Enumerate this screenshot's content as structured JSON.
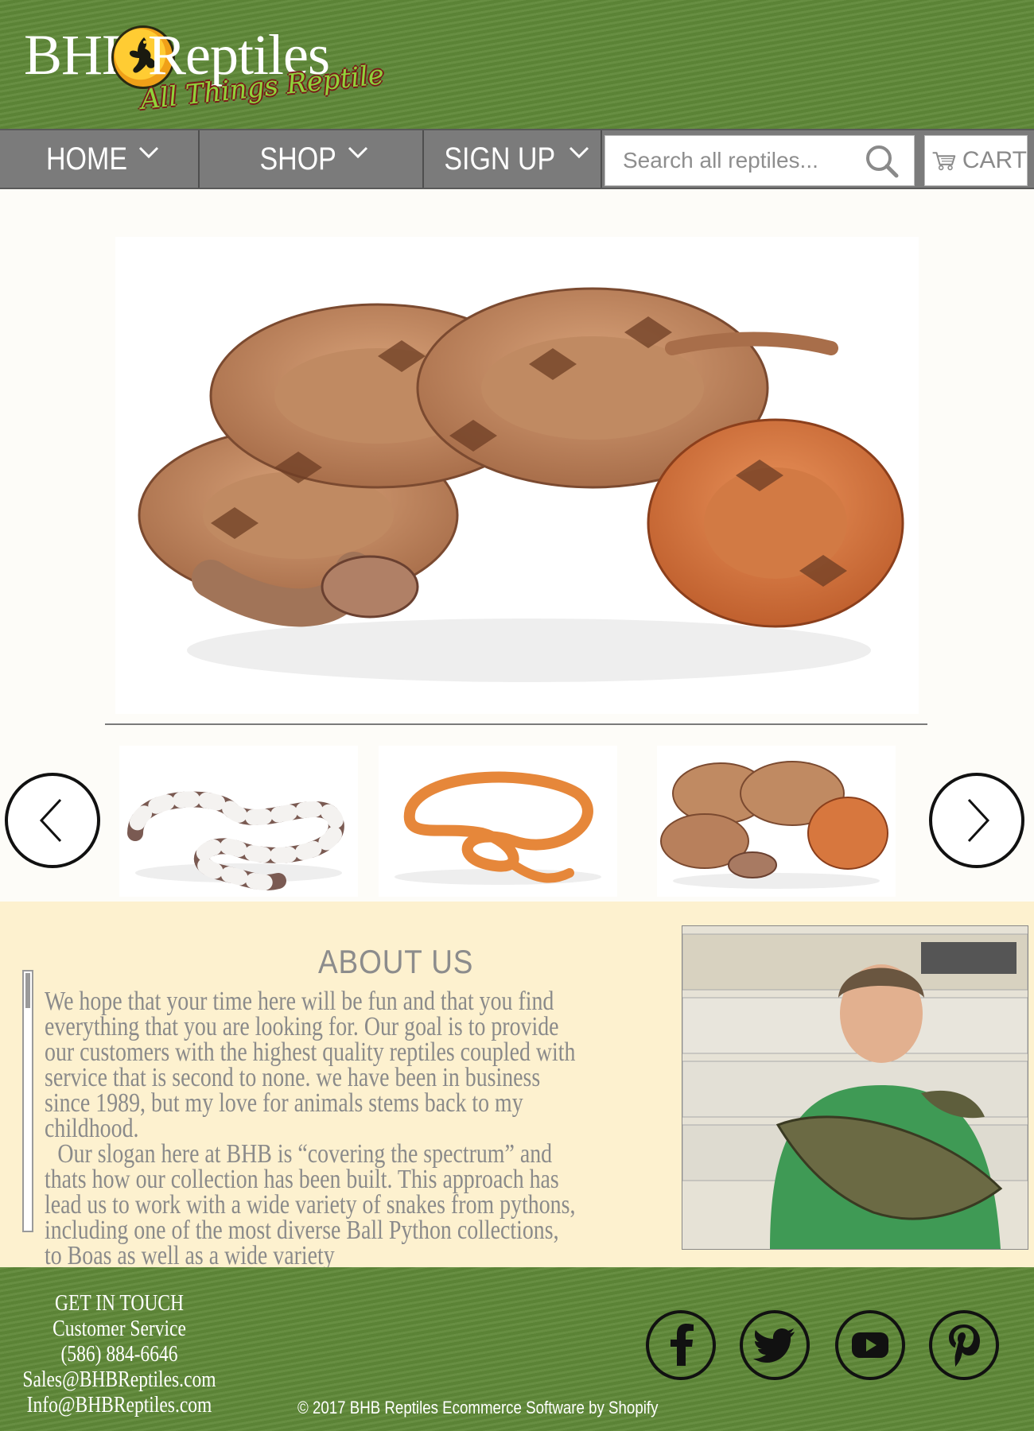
{
  "header": {
    "logo_primary": "BHB",
    "logo_secondary": "Reptiles",
    "tagline": "All Things Reptile"
  },
  "nav": {
    "items": [
      {
        "label": "HOME"
      },
      {
        "label": "SHOP"
      },
      {
        "label": "SIGN UP"
      }
    ],
    "search": {
      "placeholder": "Search all reptiles...",
      "icon": "search-icon"
    },
    "cart": {
      "label": "CART",
      "icon": "cart-icon"
    }
  },
  "hero": {
    "main_image": "boa constrictor snake photo",
    "thumbnails": [
      "king snake photo",
      "corn snake photo",
      "boa constrictor photo"
    ],
    "prev_icon": "chevron-left-icon",
    "next_icon": "chevron-right-icon"
  },
  "about": {
    "title": "ABOUT US",
    "paragraph_1": "We hope that your time here will be fun and that you find everything that you are looking for. Our goal is to provide our customers with the highest quality reptiles coupled with service that is second to none. we have been in business since 1989, but my love for animals stems back to my childhood.",
    "paragraph_2": "Our slogan here at BHB is “covering the spectrum” and thats how our collection has been built. This approach has lead us to work with a wide variety of snakes from pythons, including one of the most diverse Ball Python collections, to Boas as well as a wide variety",
    "photo": "owner holding alligator photo"
  },
  "footer": {
    "contact_title": "GET IN TOUCH",
    "contact_subtitle": "Customer Service",
    "phone": "(586) 884-6646",
    "email_sales": "Sales@BHBReptiles.com",
    "email_info": "Info@BHBReptiles.com",
    "copyright": "© 2017 BHB Reptiles  Ecommerce Software by Shopify",
    "social": [
      "facebook-icon",
      "twitter-icon",
      "youtube-icon",
      "pinterest-icon"
    ]
  },
  "colors": {
    "brand_green": "#5f8838",
    "nav_gray": "#7b7b7b",
    "about_bg": "#fdf1cf",
    "text_gray": "#8a8a8a"
  }
}
